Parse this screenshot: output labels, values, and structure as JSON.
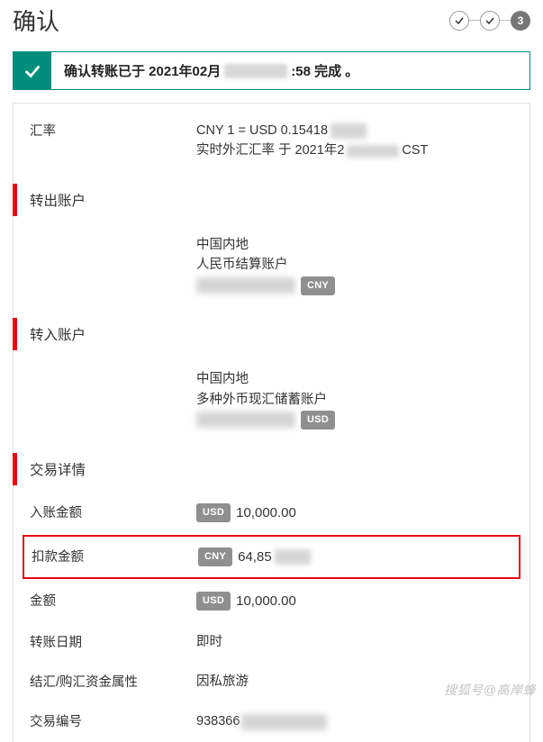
{
  "header": {
    "title": "确认",
    "step3": "3"
  },
  "alert": {
    "prefix": "确认转账已于 2021年02月",
    "suffix": ":58 完成 。"
  },
  "rate": {
    "label": "汇率",
    "line1": "CNY 1 = USD 0.15418",
    "line2a": "实时外汇汇率 于 2021年2",
    "line2b": "CST"
  },
  "from": {
    "title": "转出账户",
    "region": "中国内地",
    "acct": "人民币结算账户",
    "curr": "CNY"
  },
  "to": {
    "title": "转入账户",
    "region": "中国内地",
    "acct": "多种外币现汇储蓄账户",
    "curr": "USD"
  },
  "details": {
    "title": "交易详情",
    "credit_label": "入账金额",
    "credit_curr": "USD",
    "credit_val": "10,000.00",
    "debit_label": "扣款金额",
    "debit_curr": "CNY",
    "debit_val": "64,85",
    "amount_label": "金额",
    "amount_curr": "USD",
    "amount_val": "10,000.00",
    "date_label": "转账日期",
    "date_val": "即时",
    "purpose_label": "结汇/购汇资金属性",
    "purpose_val": "因私旅游",
    "ref_label": "交易编号",
    "ref_val": "938366"
  },
  "watermark": "搜狐号@高岸蜂"
}
